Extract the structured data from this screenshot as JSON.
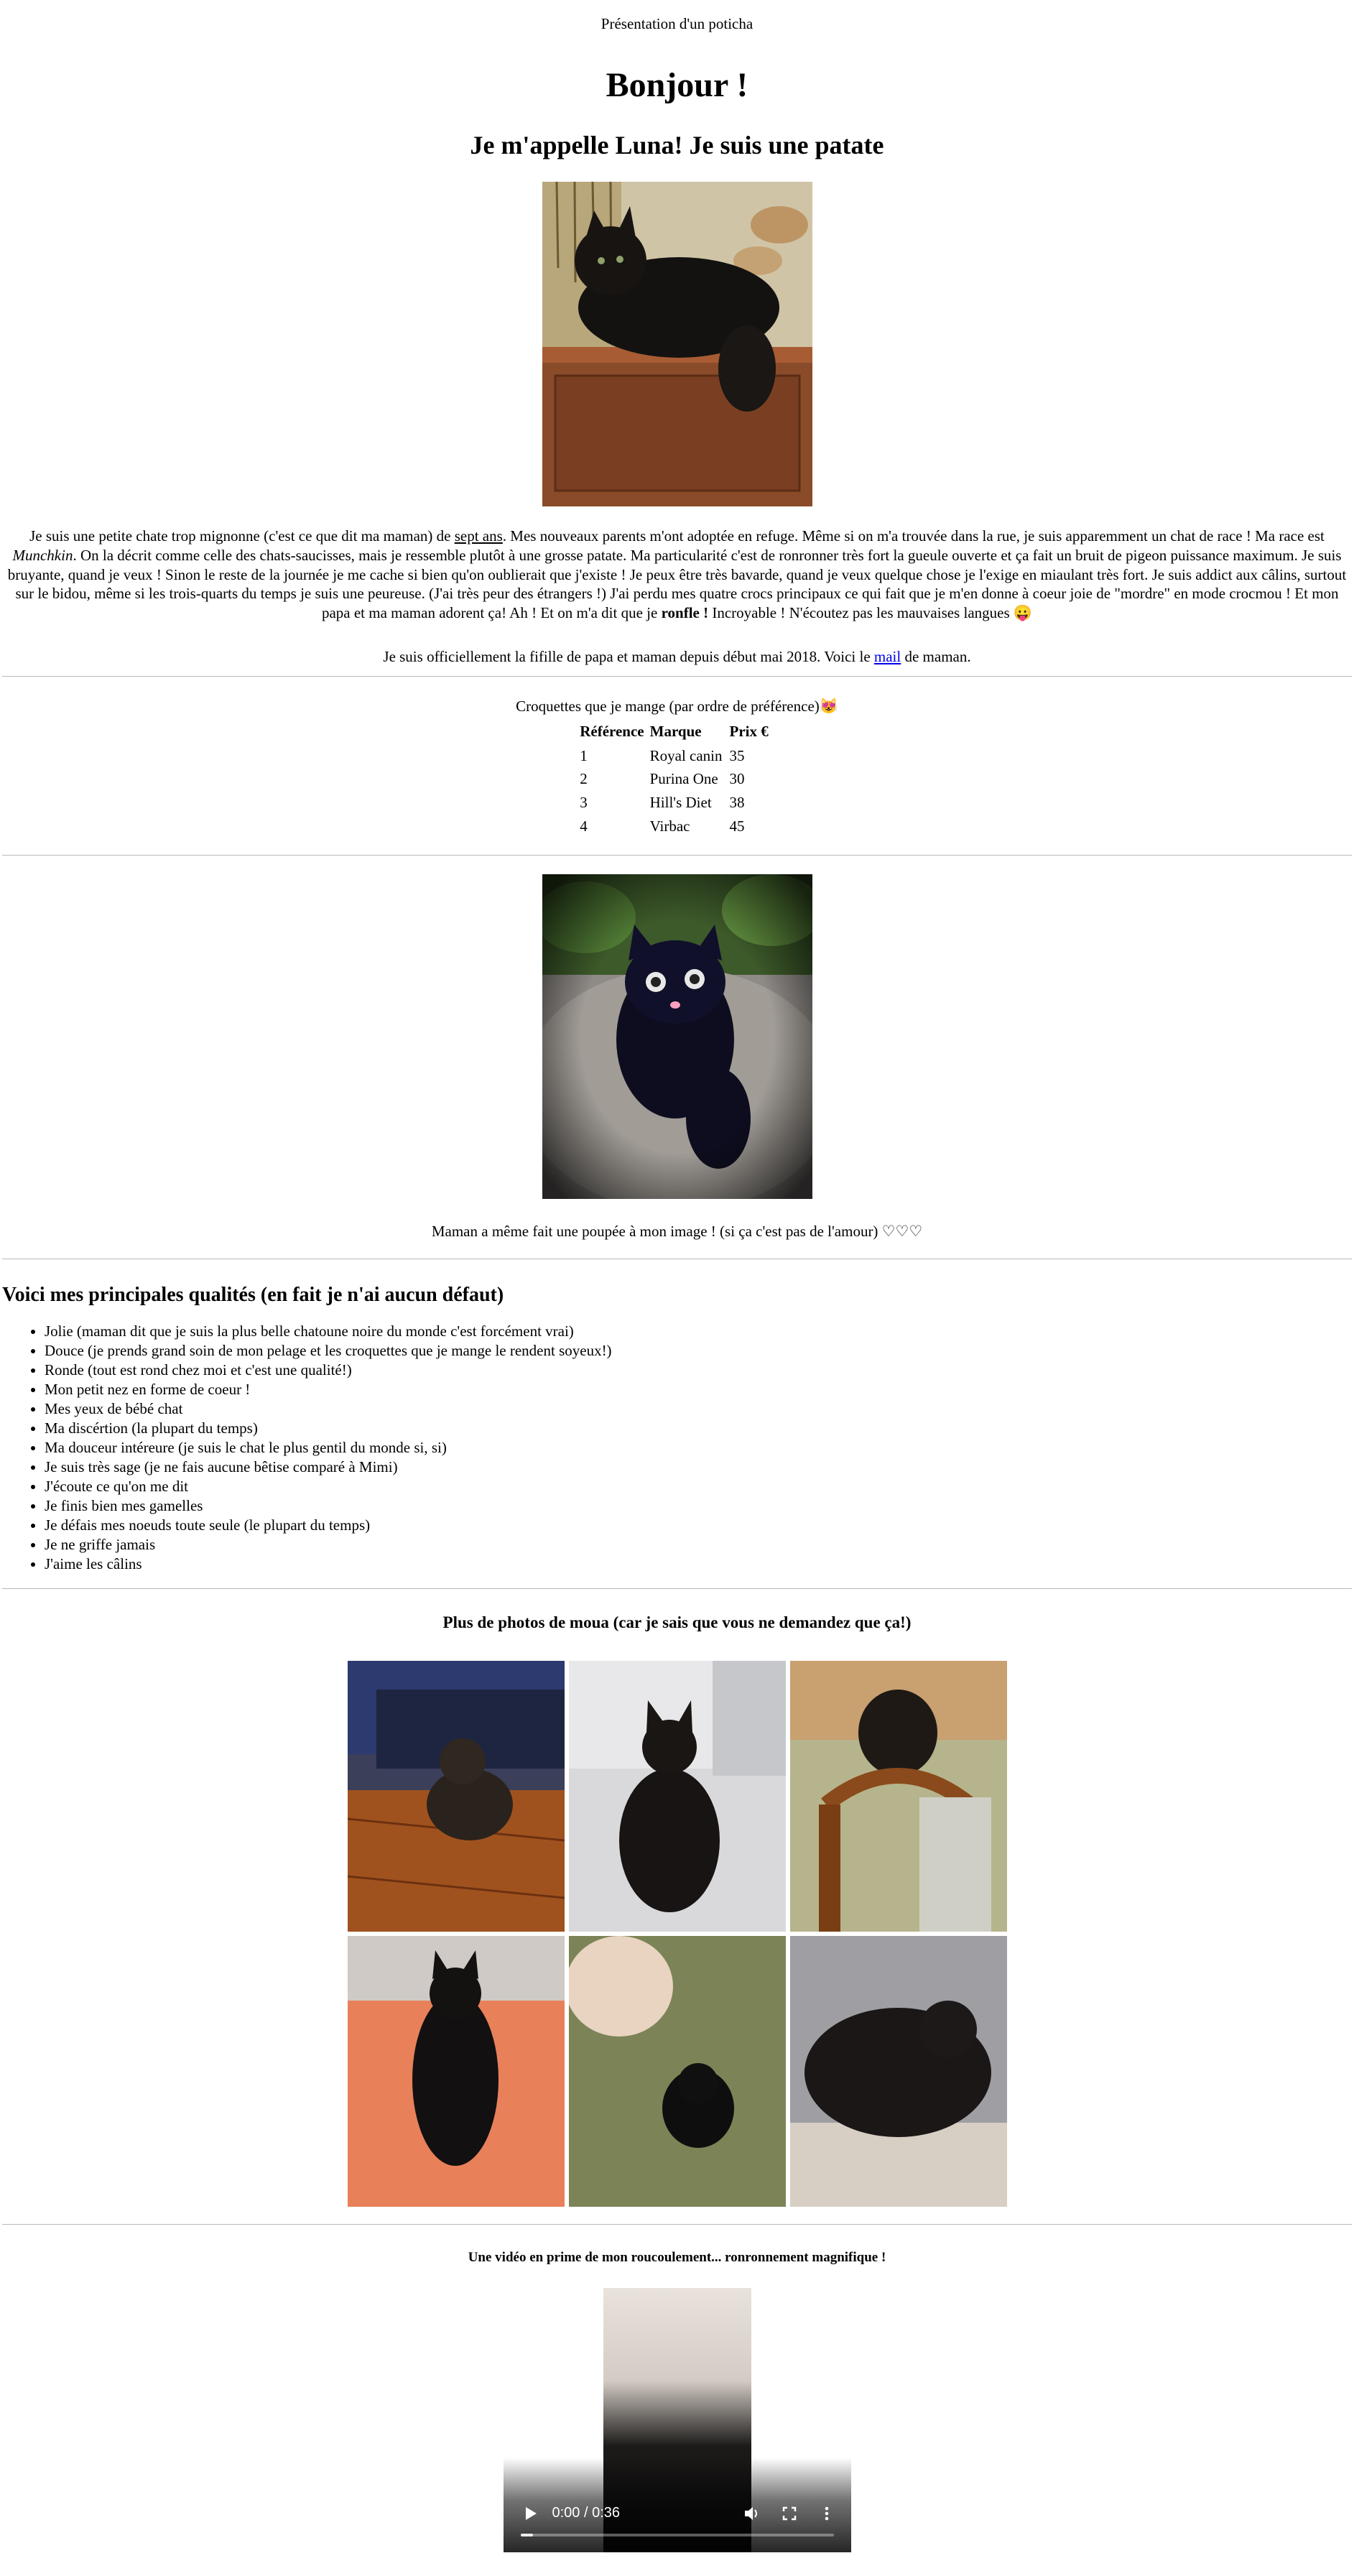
{
  "page_title": "Présentation d'un poticha",
  "heading": "Bonjour !",
  "subheading": "Je m'appelle Luna! Je suis une patate",
  "intro": {
    "p1": "Je suis une petite chate trop mignonne (c'est ce que dit ma maman) de ",
    "age": "sept ans",
    "p2": ". Mes nouveaux parents m'ont adoptée en refuge. Même si on m'a trouvée dans la rue, je suis apparemment un chat de race ! Ma race est ",
    "breed": "Munchkin",
    "p3": ". On la décrit comme celle des chats-saucisses, mais je ressemble plutôt à une grosse patate. Ma particularité c'est de ronronner très fort la gueule ouverte et ça fait un bruit de pigeon puissance maximum. Je suis bruyante, quand je veux ! Sinon le reste de la journée je me cache si bien qu'on oublierait que j'existe ! Je peux être très bavarde, quand je veux quelque chose je l'exige en miaulant très fort. Je suis addict aux câlins, surtout sur le bidou, même si les trois-quarts du temps je suis une peureuse. (J'ai très peur des étrangers !) J'ai perdu mes quatre crocs principaux ce qui fait que je m'en donne à coeur joie de \"mordre\" en mode crocmou ! Et mon papa et ma maman adorent ça! Ah ! Et on m'a dit que je ",
    "snore": "ronfle !",
    "p4": " Incroyable ! N'écoutez pas les mauvaises langues ",
    "emoji": "😛"
  },
  "adoption": {
    "before": "Je suis officiellement la fifille de papa et maman depuis début mai 2018. Voici le ",
    "link": "mail",
    "after": " de maman."
  },
  "kibble": {
    "title": "Croquettes que je mange (par ordre de préférence)",
    "emoji": "😻",
    "headers": [
      "Référence",
      "Marque",
      "Prix €"
    ],
    "rows": [
      [
        "1",
        "Royal canin",
        "35"
      ],
      [
        "2",
        "Purina One",
        "30"
      ],
      [
        "3",
        "Hill's Diet",
        "38"
      ],
      [
        "4",
        "Virbac",
        "45"
      ]
    ]
  },
  "doll_caption": "Maman a même fait une poupée à mon image ! (si ça c'est pas de l'amour) ♡♡♡",
  "qualities": {
    "title": "Voici mes principales qualités (en fait je n'ai aucun défaut)",
    "items": [
      "Jolie (maman dit que je suis la plus belle chatoune noire du monde c'est forcément vrai)",
      "Douce (je prends grand soin de mon pelage et les croquettes que je mange le rendent soyeux!)",
      "Ronde (tout est rond chez moi et c'est une qualité!)",
      "Mon petit nez en forme de coeur !",
      "Mes yeux de bébé chat",
      "Ma discértion (la plupart du temps)",
      "Ma douceur intéreure (je suis le chat le plus gentil du monde si, si)",
      "Je suis très sage (je ne fais aucune bêtise comparé à Mimi)",
      "J'écoute ce qu'on me dit",
      "Je finis bien mes gamelles",
      "Je défais mes noeuds toute seule (le plupart du temps)",
      "Je ne griffe jamais",
      "J'aime les câlins"
    ]
  },
  "more_photos_title": "Plus de photos de moua (car je sais que vous ne demandez que ça!)",
  "video": {
    "title": "Une vidéo en prime de mon roucoulement... ronronnement magnifique !",
    "time": "0:00 / 0:36",
    "progress": 0.04
  },
  "colors": {
    "link": "#0000ee",
    "rule": "#b8b8b8"
  }
}
